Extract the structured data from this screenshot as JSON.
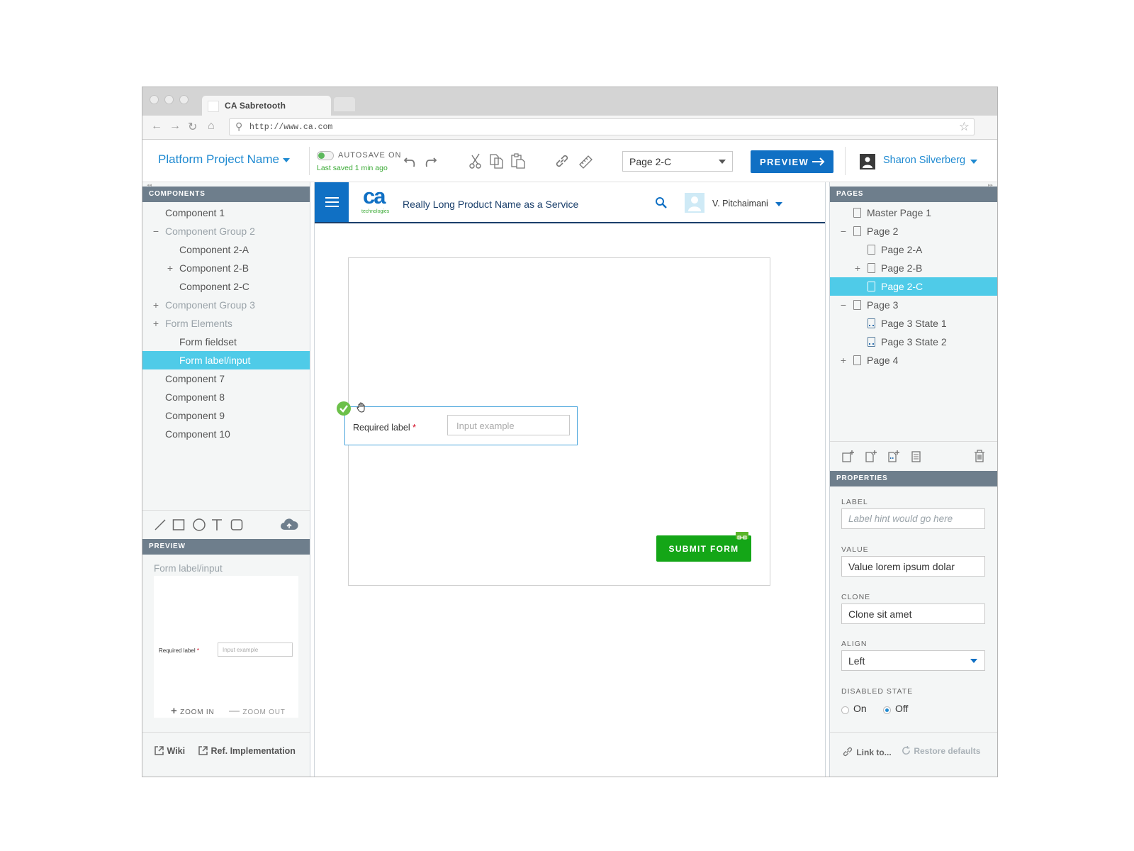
{
  "browser": {
    "tab_title": "CA Sabretooth",
    "url": "http://www.ca.com"
  },
  "toolbar": {
    "project_name": "Platform Project Name",
    "autosave_label": "AUTOSAVE ON",
    "last_saved": "Last saved 1 min ago",
    "page_select_value": "Page 2-C",
    "preview_label": "PREVIEW",
    "user_name": "Sharon Silverberg"
  },
  "components_panel": {
    "header": "COMPONENTS",
    "items": [
      {
        "label": "Component 1",
        "glyph": "",
        "level": 0
      },
      {
        "label": "Component Group 2",
        "glyph": "−",
        "level": 0
      },
      {
        "label": "Component 2-A",
        "glyph": "",
        "level": 1
      },
      {
        "label": "Component 2-B",
        "glyph": "+",
        "level": 1
      },
      {
        "label": "Component 2-C",
        "glyph": "",
        "level": 1
      },
      {
        "label": "Component Group 3",
        "glyph": "+",
        "level": 0
      },
      {
        "label": "Form Elements",
        "glyph": "+",
        "level": 0
      },
      {
        "label": "Form fieldset",
        "glyph": "",
        "level": 1
      },
      {
        "label": "Form label/input",
        "glyph": "",
        "level": 1
      },
      {
        "label": "Component 7",
        "glyph": "",
        "level": 0
      },
      {
        "label": "Component 8",
        "glyph": "",
        "level": 0
      },
      {
        "label": "Component 9",
        "glyph": "",
        "level": 0
      },
      {
        "label": "Component 10",
        "glyph": "",
        "level": 0
      }
    ],
    "selected_item": "Form label/input"
  },
  "preview_panel": {
    "header": "PREVIEW",
    "title": "Form label/input",
    "thumb_label": "Required label",
    "thumb_input_placeholder": "Input example",
    "zoom_in": "ZOOM IN",
    "zoom_out": "ZOOM OUT"
  },
  "left_footer": {
    "wiki": "Wiki",
    "ref_impl": "Ref. Implementation"
  },
  "canvas": {
    "product_name": "Really Long Product Name as a Service",
    "logo_text": "ca",
    "logo_subtext": "technologies",
    "header_user": "V. Pitchaimani",
    "form_label": "Required label",
    "form_required_mark": "*",
    "form_input_placeholder": "Input example",
    "submit_label": "SUBMIT FORM"
  },
  "pages_panel": {
    "header": "PAGES",
    "items": [
      {
        "label": "Master Page 1",
        "glyph": "",
        "level": 0,
        "kind": "page"
      },
      {
        "label": "Page 2",
        "glyph": "−",
        "level": 0,
        "kind": "page"
      },
      {
        "label": "Page 2-A",
        "glyph": "",
        "level": 1,
        "kind": "page"
      },
      {
        "label": "Page 2-B",
        "glyph": "+",
        "level": 1,
        "kind": "page"
      },
      {
        "label": "Page 2-C",
        "glyph": "",
        "level": 1,
        "kind": "page"
      },
      {
        "label": "Page 3",
        "glyph": "−",
        "level": 0,
        "kind": "page"
      },
      {
        "label": "Page 3 State 1",
        "glyph": "",
        "level": 1,
        "kind": "state"
      },
      {
        "label": "Page 3 State 2",
        "glyph": "",
        "level": 1,
        "kind": "state"
      },
      {
        "label": "Page 4",
        "glyph": "+",
        "level": 0,
        "kind": "page"
      }
    ],
    "selected_item": "Page 2-C"
  },
  "properties_panel": {
    "header": "PROPERTIES",
    "label_title": "LABEL",
    "label_placeholder": "Label hint would go here",
    "value_title": "VALUE",
    "value_value": "Value lorem ipsum dolar",
    "clone_title": "CLONE",
    "clone_value": "Clone sit amet",
    "align_title": "ALIGN",
    "align_value": "Left",
    "disabled_title": "DISABLED STATE",
    "disabled_on": "On",
    "disabled_off": "Off",
    "disabled_selected": "Off"
  },
  "right_footer": {
    "link_to": "Link to...",
    "restore": "Restore defaults"
  },
  "colors": {
    "accent_blue": "#1f8ad1",
    "selection_cyan": "#4fcbe8",
    "submit_green": "#14a617",
    "header_navy": "#1a3f6b"
  }
}
